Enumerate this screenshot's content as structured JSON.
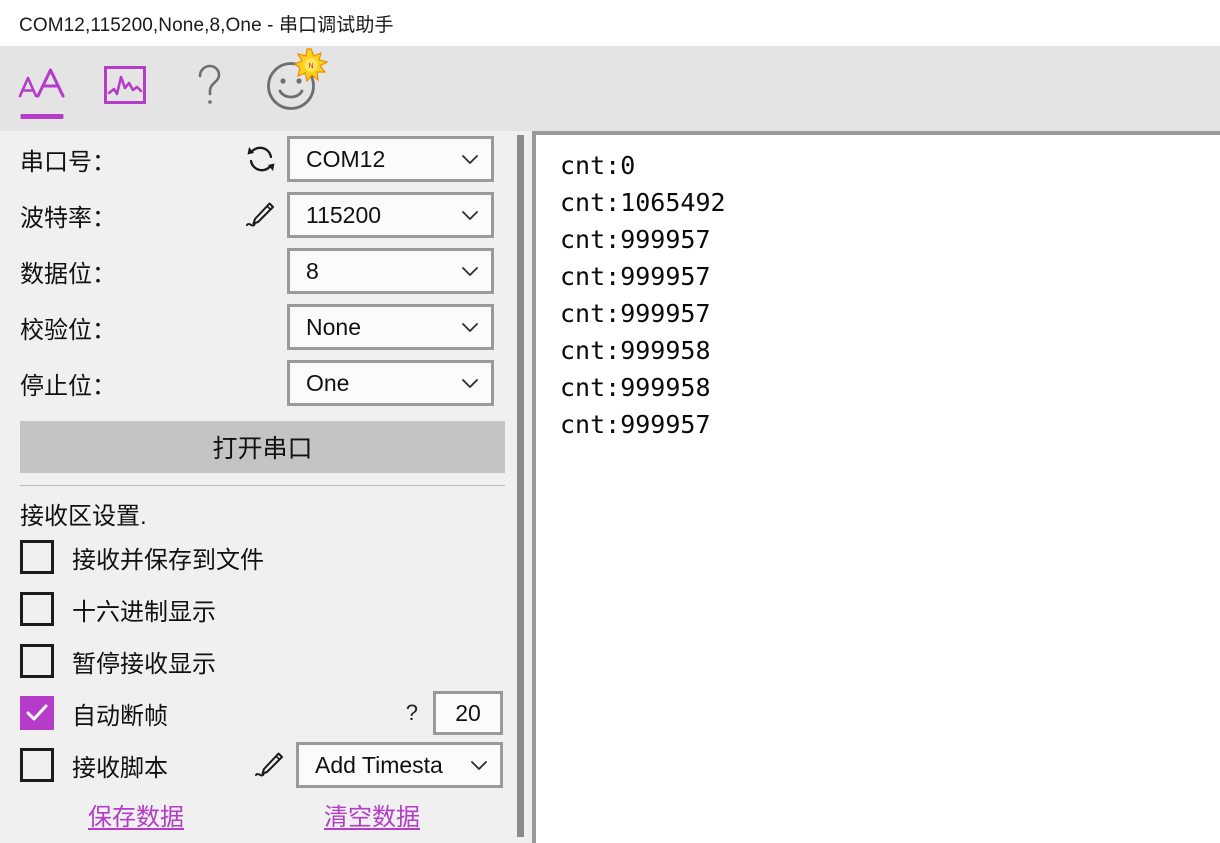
{
  "window": {
    "title": "COM12,115200,None,8,One - 串口调试助手"
  },
  "toolbar": {
    "items": [
      {
        "name": "font-size-tool",
        "icon": "font-size-icon",
        "label": "aA",
        "active": true
      },
      {
        "name": "waveform-tool",
        "icon": "waveform-icon",
        "label": "",
        "active": false
      },
      {
        "name": "help-tool",
        "icon": "question-icon",
        "label": "?",
        "active": false
      },
      {
        "name": "about-tool",
        "icon": "smiley-icon",
        "label": "",
        "active": false
      }
    ],
    "badge_text": "NEW"
  },
  "settings": {
    "rows": [
      {
        "label": "串口号：",
        "icon": "refresh-icon",
        "value": "COM12"
      },
      {
        "label": "波特率：",
        "icon": "pen-icon",
        "value": "115200"
      },
      {
        "label": "数据位：",
        "icon": "",
        "value": "8"
      },
      {
        "label": "校验位：",
        "icon": "",
        "value": "None"
      },
      {
        "label": "停止位：",
        "icon": "",
        "value": "One"
      }
    ],
    "open_button": "打开串口",
    "section_title": "接收区设置.",
    "checkboxes": [
      {
        "label": "接收并保存到文件",
        "checked": false
      },
      {
        "label": "十六进制显示",
        "checked": false
      },
      {
        "label": "暂停接收显示",
        "checked": false
      },
      {
        "label": "自动断帧",
        "checked": true
      },
      {
        "label": "接收脚本",
        "checked": false
      }
    ],
    "autoframe_help": "?",
    "autoframe_value": "20",
    "script_value": "Add Timesta",
    "links": [
      {
        "label": "保存数据"
      },
      {
        "label": "清空数据"
      }
    ]
  },
  "receive": {
    "lines": [
      "cnt:0",
      "cnt:1065492",
      "cnt:999957",
      "cnt:999957",
      "cnt:999957",
      "cnt:999958",
      "cnt:999958",
      "cnt:999957"
    ]
  },
  "colors": {
    "accent": "#b43cc8",
    "panel_bg": "#f0f0f0",
    "toolbar_bg": "#e4e4e4",
    "button_bg": "#c4c4c4",
    "border": "#9a9a9a",
    "text": "#111111"
  }
}
